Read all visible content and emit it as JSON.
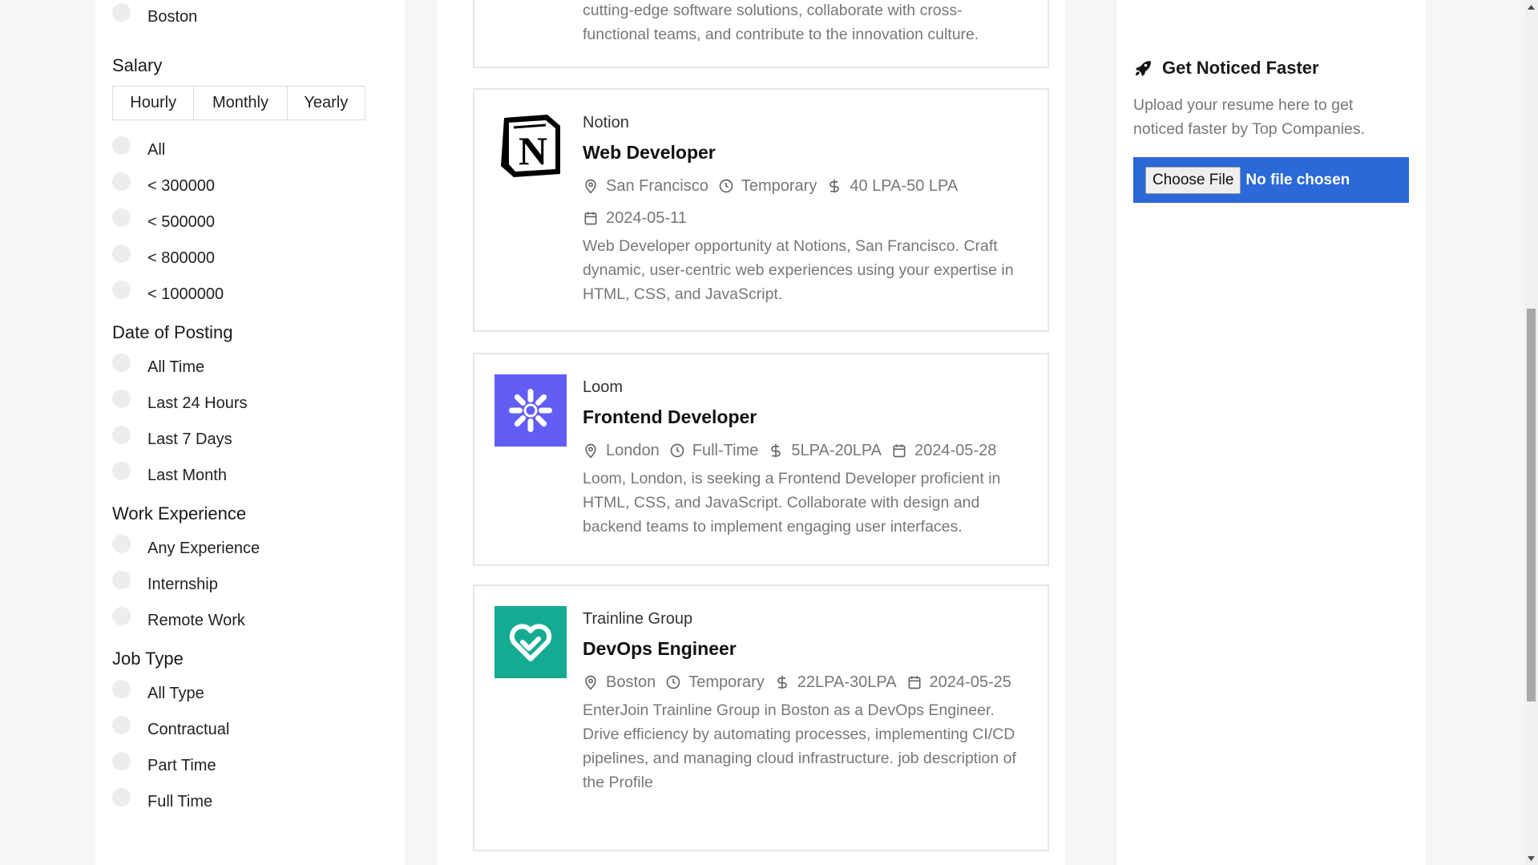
{
  "filters": {
    "location_visible": {
      "label": "Boston"
    },
    "salary": {
      "title": "Salary",
      "tabs": [
        "Hourly",
        "Monthly",
        "Yearly"
      ],
      "options": [
        "All",
        "< 300000",
        "< 500000",
        "< 800000",
        "< 1000000"
      ]
    },
    "date": {
      "title": "Date of Posting",
      "options": [
        "All Time",
        "Last 24 Hours",
        "Last 7 Days",
        "Last Month"
      ]
    },
    "experience": {
      "title": "Work Experience",
      "options": [
        "Any Experience",
        "Internship",
        "Remote Work"
      ]
    },
    "job_type": {
      "title": "Job Type",
      "options": [
        "All Type",
        "Contractual",
        "Part Time",
        "Full Time"
      ]
    }
  },
  "jobs": {
    "partial": {
      "desc": "cutting-edge software solutions, collaborate with cross-functional teams, and contribute to the innovation culture."
    },
    "notion": {
      "company": "Notion",
      "title": "Web Developer",
      "location": "San Francisco",
      "type": "Temporary",
      "salary": "40 LPA-50 LPA",
      "date": "2024-05-11",
      "desc": "Web Developer opportunity at Notions, San Francisco. Craft dynamic, user-centric web experiences using your expertise in HTML, CSS, and JavaScript.",
      "logo_text": "N"
    },
    "loom": {
      "company": "Loom",
      "title": "Frontend Developer",
      "location": "London",
      "type": "Full-Time",
      "salary": "5LPA-20LPA",
      "date": "2024-05-28",
      "desc": "Loom, London, is seeking a Frontend Developer proficient in HTML, CSS, and JavaScript. Collaborate with design and backend teams to implement engaging user interfaces."
    },
    "trainline": {
      "company": "Trainline Group",
      "title": "DevOps Engineer",
      "location": "Boston",
      "type": "Temporary",
      "salary": "22LPA-30LPA",
      "date": "2024-05-25",
      "desc": "EnterJoin Trainline Group in Boston as a DevOps Engineer. Drive efficiency by automating processes, implementing CI/CD pipelines, and managing cloud infrastructure. job description of the Profile"
    }
  },
  "right_panel": {
    "title": "Get Noticed Faster",
    "text": "Upload your resume here to get noticed faster by Top Companies.",
    "choose_file": "Choose File",
    "no_file": "No file chosen"
  },
  "colors": {
    "upload_bg": "#2b68d8",
    "loom_logo": "#625df5",
    "trainline_logo": "#15ab92"
  }
}
